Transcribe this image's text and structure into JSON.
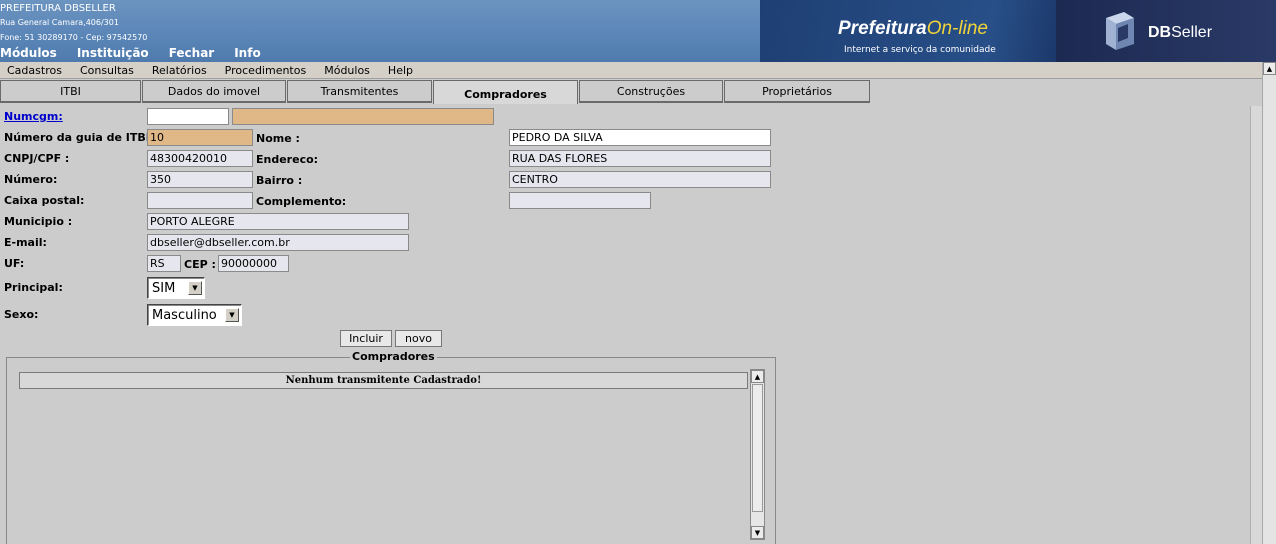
{
  "header": {
    "org_name": "PREFEITURA DBSELLER",
    "address": "Rua General Camara,406/301",
    "phone_line": "Fone: 51 30289170  -  Cep: 97542570",
    "top_menu": [
      "Módulos",
      "Instituição",
      "Fechar",
      "Info"
    ],
    "logo_prefeitura": "Prefeitura",
    "logo_online": "On-line",
    "logo_slogan": "Internet a serviço da comunidade",
    "logo_db_bold": "DB",
    "logo_db_rest": "Seller"
  },
  "menubar": [
    "Cadastros",
    "Consultas",
    "Relatórios",
    "Procedimentos",
    "Módulos",
    "Help"
  ],
  "tabs": [
    "ITBI",
    "Dados do imovel",
    "Transmitentes",
    "Compradores",
    "Construções",
    "Proprietários"
  ],
  "active_tab": "Compradores",
  "form": {
    "numcgm_label": "Numcgm:",
    "numcgm_value": "",
    "numcgm_name_value": "",
    "guia_label": "Número da guia de ITBI:",
    "guia_value": "10",
    "nome_label": "Nome :",
    "nome_value": "PEDRO DA SILVA",
    "cnpj_label": "CNPJ/CPF :",
    "cnpj_value": "48300420010",
    "endereco_label": "Endereco:",
    "endereco_value": "RUA DAS FLORES",
    "numero_label": "Número:",
    "numero_value": "350",
    "bairro_label": "Bairro :",
    "bairro_value": "CENTRO",
    "caixa_label": "Caixa postal:",
    "caixa_value": "",
    "complemento_label": "Complemento:",
    "complemento_value": "",
    "municipio_label": "Municipio :",
    "municipio_value": "PORTO ALEGRE",
    "email_label": "E-mail:",
    "email_value": "dbseller@dbseller.com.br",
    "uf_label": "UF:",
    "uf_value": "RS",
    "cep_label": "CEP :",
    "cep_value": "90000000",
    "principal_label": "Principal:",
    "principal_value": "SIM",
    "sexo_label": "Sexo:",
    "sexo_value": "Masculino",
    "incluir_label": "Incluir",
    "novo_label": "novo"
  },
  "grid": {
    "legend": "Compradores",
    "empty_message": "Nenhum transmitente Cadastrado!"
  }
}
